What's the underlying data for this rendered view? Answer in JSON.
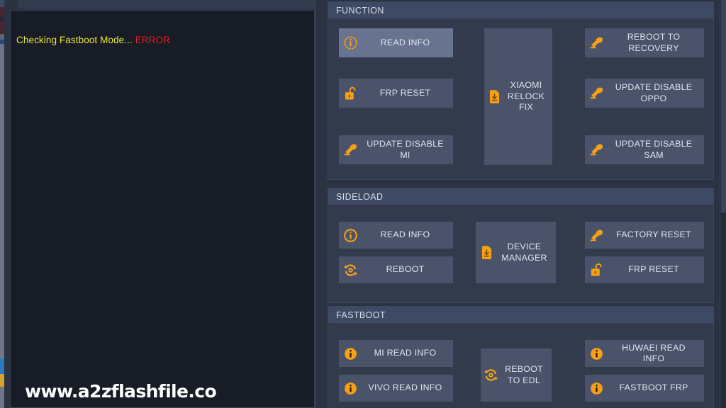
{
  "app": {
    "background_color": "#2b3242",
    "panel_color": "#323a4c",
    "panel_header_color": "#3e4a63",
    "button_color": "#4a5369",
    "button_highlight_color": "#68738f",
    "icon_accent_color": "#f5a015",
    "text_color": "#dfe4ee"
  },
  "log": {
    "message": "Checking Fastboot Mode...",
    "status": "ERROR",
    "message_color": "#e8e832",
    "status_color": "#e02020"
  },
  "watermark": {
    "text": "www.a2zflashfile.co"
  },
  "panels": [
    {
      "id": "function",
      "title": "FUNCTION",
      "buttons": {
        "left": [
          {
            "label": "READ INFO",
            "icon": "info-circle-icon",
            "highlighted": true
          },
          {
            "label": "FRP RESET",
            "icon": "unlock-padlock-icon",
            "highlighted": false
          },
          {
            "label": "UPDATE DISABLE\nMI",
            "icon": "hammer-icon",
            "highlighted": false
          }
        ],
        "middle": [
          {
            "label": "XIAOMI\nRELOCK\nFIX",
            "icon": "sim-download-icon",
            "highlighted": false
          }
        ],
        "right": [
          {
            "label": "REBOOT TO\nRECOVERY",
            "icon": "hammer-icon",
            "highlighted": false
          },
          {
            "label": "UPDATE DISABLE\nOPPO",
            "icon": "hammer-icon",
            "highlighted": false
          },
          {
            "label": "UPDATE DISABLE\nSAM",
            "icon": "hammer-icon",
            "highlighted": false
          }
        ]
      }
    },
    {
      "id": "sideload",
      "title": "SIDELOAD",
      "buttons": {
        "left": [
          {
            "label": "READ INFO",
            "icon": "info-circle-icon",
            "highlighted": false
          },
          {
            "label": "REBOOT",
            "icon": "refresh-icon",
            "highlighted": false
          }
        ],
        "middle": [
          {
            "label": "DEVICE\nMANAGER",
            "icon": "sim-download-icon",
            "highlighted": false
          }
        ],
        "right": [
          {
            "label": "FACTORY RESET",
            "icon": "hammer-icon",
            "highlighted": false
          },
          {
            "label": "FRP RESET",
            "icon": "unlock-padlock-icon",
            "highlighted": false
          }
        ]
      }
    },
    {
      "id": "fastboot",
      "title": "FASTBOOT",
      "buttons": {
        "left": [
          {
            "label": "MI READ INFO",
            "icon": "info-badge-icon",
            "highlighted": false
          },
          {
            "label": "VIVO READ INFO",
            "icon": "info-badge-icon",
            "highlighted": false
          }
        ],
        "middle": [
          {
            "label": "REBOOT\nTO EDL",
            "icon": "refresh-icon",
            "highlighted": false
          }
        ],
        "right": [
          {
            "label": "HUWAEI READ\nINFO",
            "icon": "info-badge-icon",
            "highlighted": false
          },
          {
            "label": "FASTBOOT FRP",
            "icon": "info-badge-icon",
            "highlighted": false
          }
        ]
      }
    }
  ]
}
